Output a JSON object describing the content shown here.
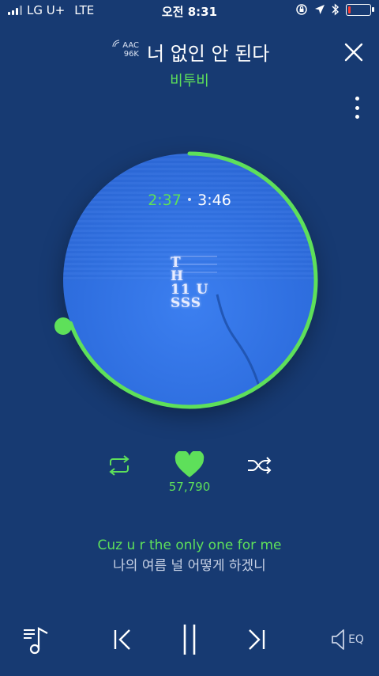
{
  "status_bar": {
    "carrier": "LG U+",
    "network": "LTE",
    "time": "오전 8:31",
    "battery_level": 0.1
  },
  "now_playing": {
    "codec_line1": "AAC",
    "codec_line2": "96K",
    "title": "너 없인 안 된다",
    "artist": "비투비",
    "elapsed": "2:37",
    "separator": "•",
    "duration": "3:46",
    "progress": 0.695,
    "album_art_text": [
      "T",
      "H",
      "11",
      "SSS",
      "U"
    ]
  },
  "actions": {
    "like_count": "57,790"
  },
  "lyrics": {
    "current": "Cuz u r the only one for me",
    "next": "나의 여름 널 어떻게 하겠니"
  },
  "bottom_bar": {
    "eq_label": "EQ"
  },
  "colors": {
    "background": "#173a72",
    "accent_green": "#5ee05a",
    "disc_blue": "#2f6fe0"
  },
  "icons": [
    "close-icon",
    "more-icon",
    "repeat-icon",
    "heart-icon",
    "shuffle-icon",
    "playlist-icon",
    "previous-icon",
    "pause-icon",
    "next-icon",
    "equalizer-icon"
  ]
}
